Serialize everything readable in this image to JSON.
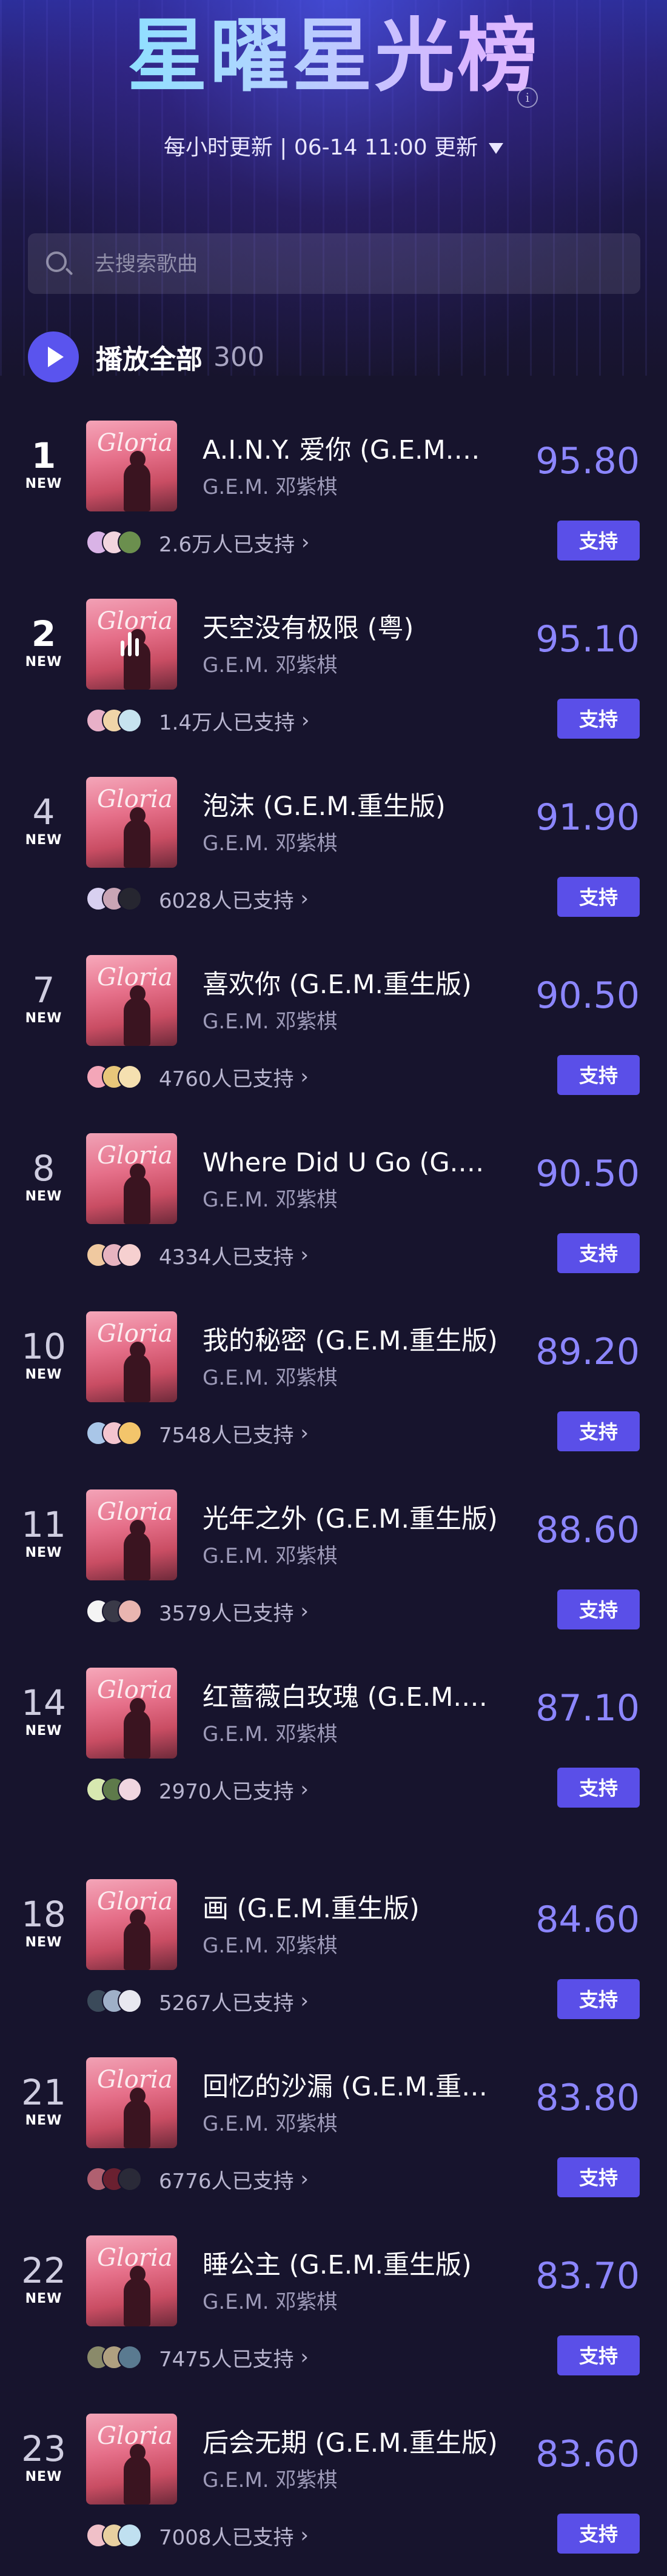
{
  "header": {
    "title": "星曜星光榜",
    "update_text": "每小时更新 | 06-14 11:00 更新",
    "info_icon": "info-icon",
    "dropdown_icon": "caret-down-icon"
  },
  "search": {
    "placeholder": "去搜索歌曲",
    "icon": "search-icon"
  },
  "play_all": {
    "label": "播放全部",
    "count": "300",
    "icon": "play-icon"
  },
  "support_button_label": "支持",
  "colors": {
    "accent": "#5a4fe8",
    "score": "#8c86ff",
    "background": "#17142d"
  },
  "songs": [
    {
      "rank": "1",
      "tag": "NEW",
      "title": "A.I.N.Y. 爱你 (G.E.M.重生版)",
      "artist": "G.E.M. 邓紫棋",
      "score": "95.80",
      "supporters": "2.6万人已支持"
    },
    {
      "rank": "2",
      "tag": "NEW",
      "title": "天空没有极限 (粤)",
      "artist": "G.E.M. 邓紫棋",
      "score": "95.10",
      "supporters": "1.4万人已支持",
      "playing": true
    },
    {
      "rank": "4",
      "tag": "NEW",
      "title": "泡沫 (G.E.M.重生版)",
      "artist": "G.E.M. 邓紫棋",
      "score": "91.90",
      "supporters": "6028人已支持"
    },
    {
      "rank": "7",
      "tag": "NEW",
      "title": "喜欢你 (G.E.M.重生版)",
      "artist": "G.E.M. 邓紫棋",
      "score": "90.50",
      "supporters": "4760人已支持"
    },
    {
      "rank": "8",
      "tag": "NEW",
      "title": "Where Did U Go (G.E.M.重生版)",
      "artist": "G.E.M. 邓紫棋",
      "score": "90.50",
      "supporters": "4334人已支持"
    },
    {
      "rank": "10",
      "tag": "NEW",
      "title": "我的秘密 (G.E.M.重生版)",
      "artist": "G.E.M. 邓紫棋",
      "score": "89.20",
      "supporters": "7548人已支持"
    },
    {
      "rank": "11",
      "tag": "NEW",
      "title": "光年之外 (G.E.M.重生版)",
      "artist": "G.E.M. 邓紫棋",
      "score": "88.60",
      "supporters": "3579人已支持"
    },
    {
      "rank": "14",
      "tag": "NEW",
      "title": "红蔷薇白玫瑰 (G.E.M.重生版)",
      "artist": "G.E.M. 邓紫棋",
      "score": "87.10",
      "supporters": "2970人已支持"
    },
    {
      "rank": "18",
      "tag": "NEW",
      "title": "画 (G.E.M.重生版)",
      "artist": "G.E.M. 邓紫棋",
      "score": "84.60",
      "supporters": "5267人已支持"
    },
    {
      "rank": "21",
      "tag": "NEW",
      "title": "回忆的沙漏 (G.E.M.重生版)",
      "artist": "G.E.M. 邓紫棋",
      "score": "83.80",
      "supporters": "6776人已支持"
    },
    {
      "rank": "22",
      "tag": "NEW",
      "title": "睡公主 (G.E.M.重生版)",
      "artist": "G.E.M. 邓紫棋",
      "score": "83.70",
      "supporters": "7475人已支持"
    },
    {
      "rank": "23",
      "tag": "NEW",
      "title": "后会无期 (G.E.M.重生版)",
      "artist": "G.E.M. 邓紫棋",
      "score": "83.60",
      "supporters": "7008人已支持"
    }
  ]
}
